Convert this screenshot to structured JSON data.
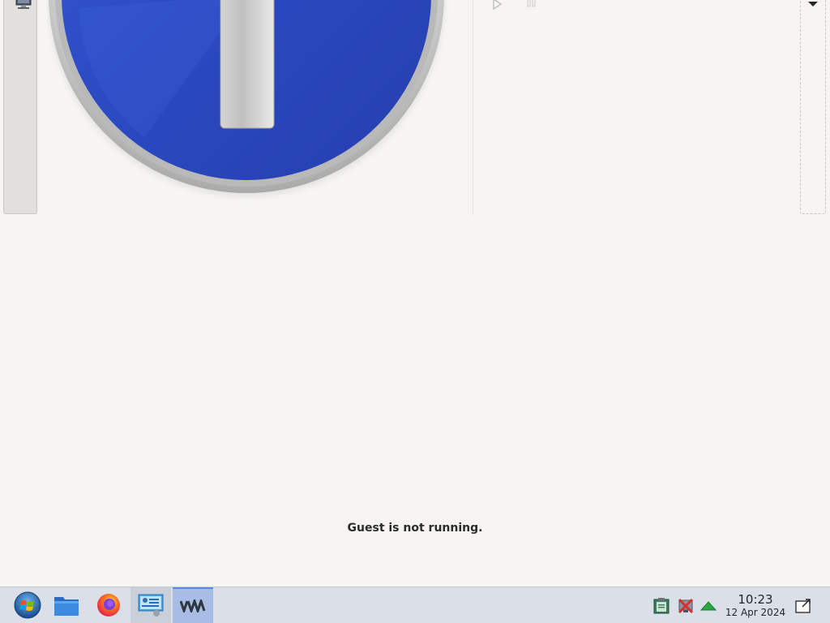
{
  "status": {
    "message": "Guest is not running."
  },
  "toolbar": {
    "play_icon": "play-icon",
    "pause_icon": "pause-icon",
    "dropdown_icon": "chevron-down-icon"
  },
  "taskbar": {
    "launchers": [
      {
        "name": "start-menu",
        "icon": "windows-logo-icon"
      },
      {
        "name": "file-manager",
        "icon": "folder-icon"
      },
      {
        "name": "firefox",
        "icon": "firefox-icon"
      },
      {
        "name": "system-settings",
        "icon": "settings-panel-icon"
      },
      {
        "name": "virtual-machine-manager",
        "icon": "vmm-icon"
      }
    ],
    "tray": [
      {
        "name": "clipboard",
        "icon": "clipboard-icon"
      },
      {
        "name": "network-disconnected",
        "icon": "network-disconnected-icon"
      },
      {
        "name": "updates",
        "icon": "green-arrow-up-icon"
      }
    ],
    "clock": {
      "time": "10:23",
      "date": "12 Apr 2024"
    }
  },
  "colors": {
    "background": "#f6f5f3",
    "taskbar": "#dbe0e8",
    "info_blue": "#2d4fc4",
    "active_task": "#a8bde6"
  }
}
